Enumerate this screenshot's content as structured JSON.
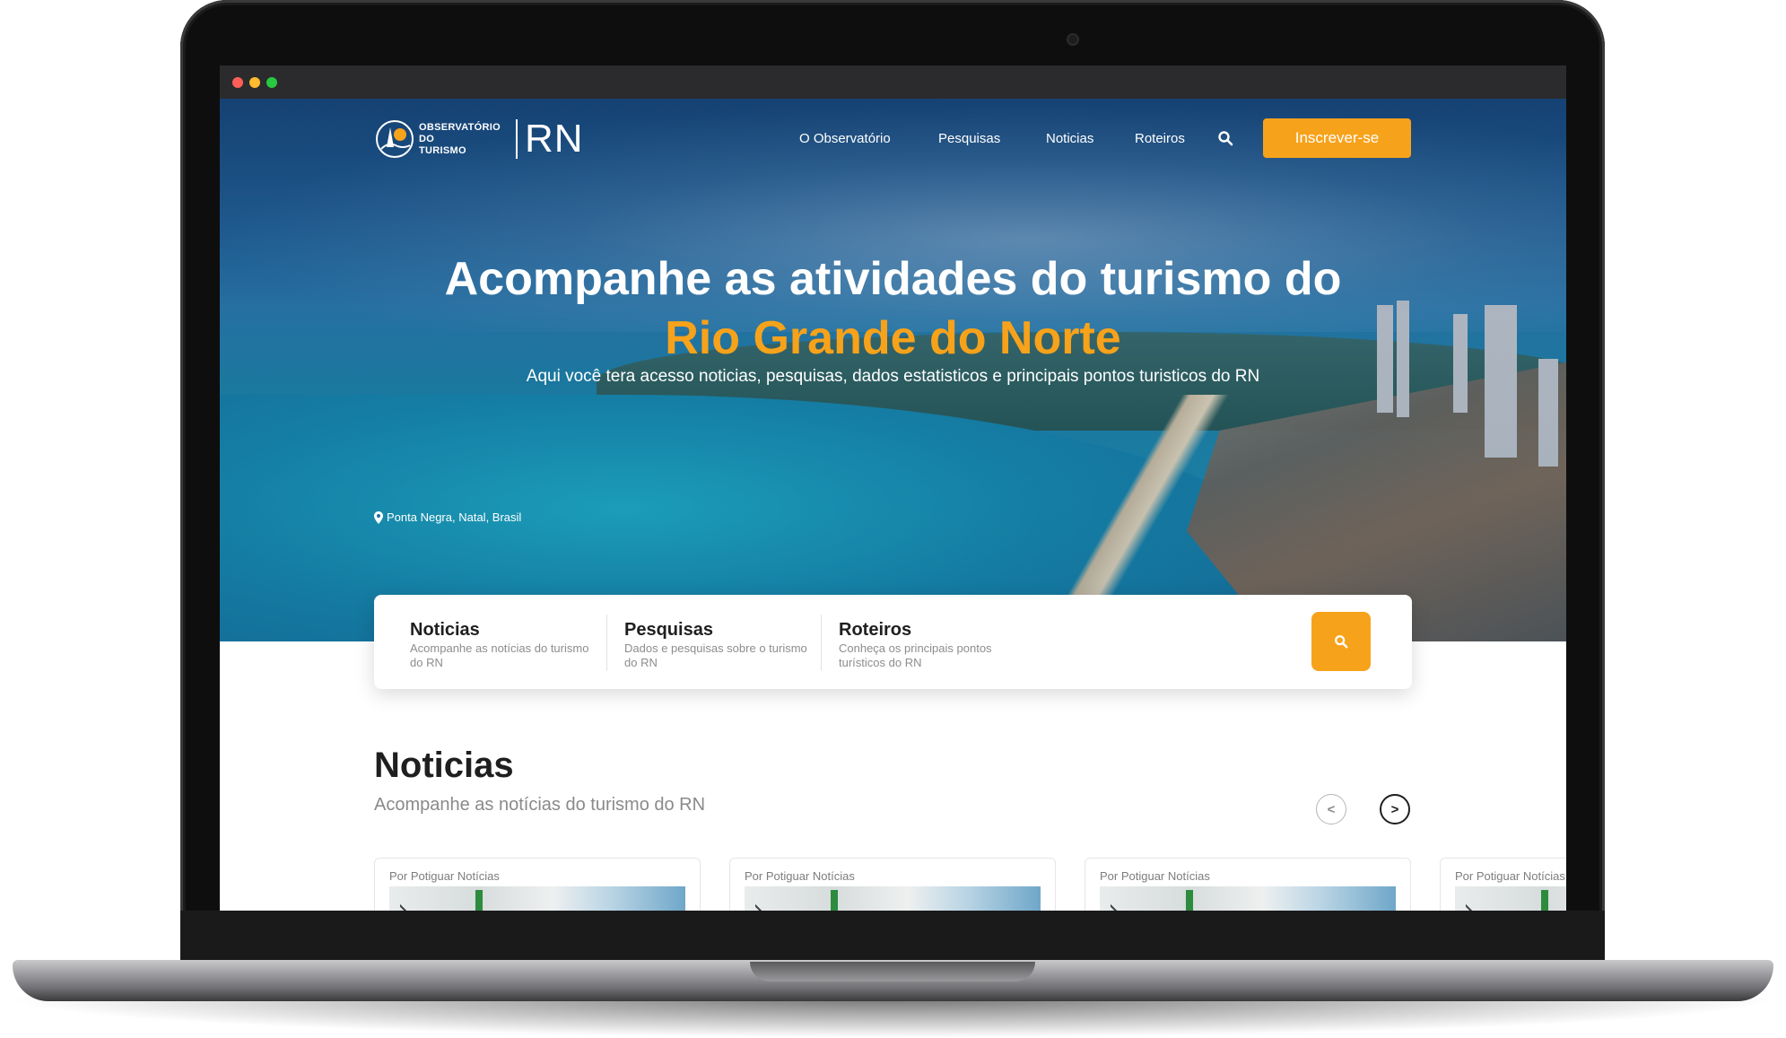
{
  "hero": {
    "title": "Acompanhe as atividades do turismo do",
    "title_accent": "Rio Grande do Norte",
    "subtitle": "Aqui você tera acesso noticias, pesquisas, dados estatisticos e principais pontos turisticos do RN",
    "location": "Ponta Negra, Natal, Brasil"
  },
  "logo": {
    "line1": "OBSERVATÓRIO DO",
    "line2": "TURISMO",
    "rn": "RN"
  },
  "nav": {
    "items": [
      "O Observatório",
      "Pesquisas",
      "Noticias",
      "Roteiros"
    ],
    "subscribe": "Inscrever-se"
  },
  "quick_links": [
    {
      "title": "Noticias",
      "description": "Acompanhe as notícias do turismo do RN"
    },
    {
      "title": "Pesquisas",
      "description": "Dados e pesquisas sobre o turismo do RN"
    },
    {
      "title": "Roteiros",
      "description": "Conheça os principais pontos turísticos do RN"
    }
  ],
  "news": {
    "title": "Noticias",
    "subtitle": "Acompanhe as notícias do turismo do RN",
    "prev": "<",
    "next": ">",
    "cards": [
      {
        "author": "Por Potiguar Notícias"
      },
      {
        "author": "Por Potiguar Notícias"
      },
      {
        "author": "Por Potiguar Notícias"
      },
      {
        "author": "Por Potiguar Notícias"
      }
    ]
  },
  "colors": {
    "accent": "#f7a21b",
    "text_dark": "#1f1f1f",
    "text_muted": "#8a8a8a"
  },
  "icons": {
    "nav_search": "search-icon",
    "quick_search": "search-icon",
    "location": "map-pin-icon"
  }
}
